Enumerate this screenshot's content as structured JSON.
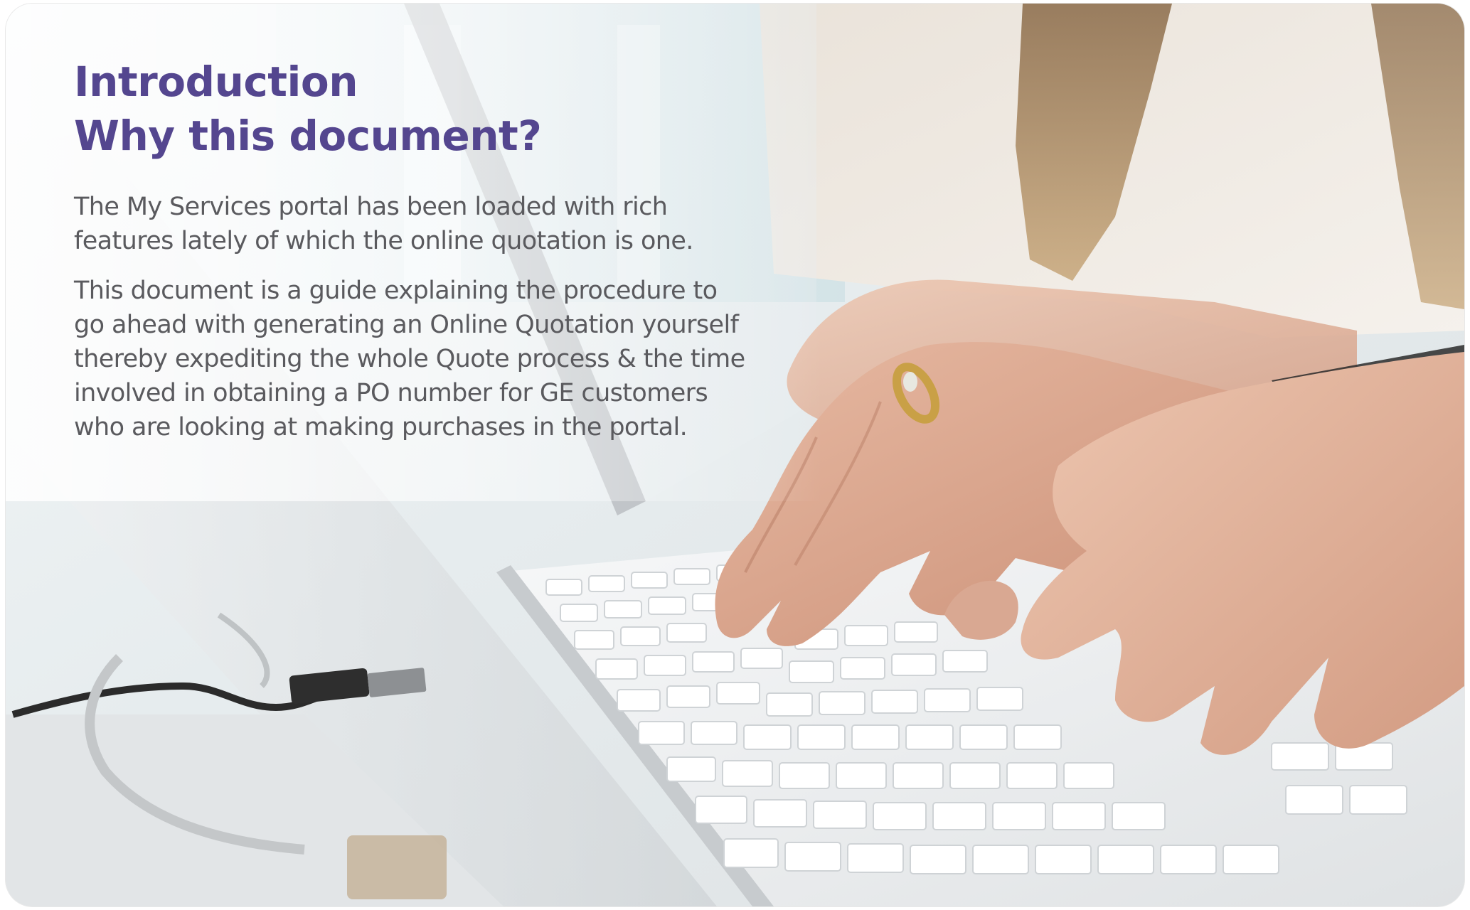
{
  "heading": {
    "line1": "Introduction",
    "line2": "Why this document?"
  },
  "body": {
    "paragraph1": [
      "The My Services portal has been loaded with rich",
      "features lately of which the online quotation is one."
    ],
    "paragraph2": [
      "This document is a guide explaining the procedure to",
      "go ahead with generating an Online Quotation yourself",
      "thereby expediting the whole Quote process & the time",
      "involved in obtaining a PO number for GE customers",
      "who are looking at making purchases in the portal."
    ]
  },
  "colors": {
    "heading": "#54468f",
    "body_text": "#5a5a5e"
  },
  "image": {
    "subject": "hands typing on a white keyboard with laptop and usb cable"
  }
}
